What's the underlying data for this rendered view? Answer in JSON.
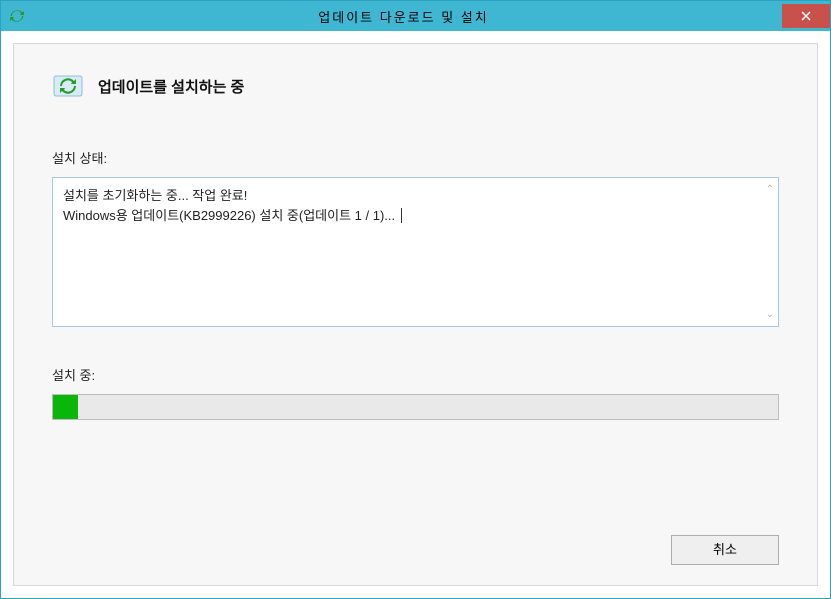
{
  "titlebar": {
    "title": "업데이트 다운로드 및 설치"
  },
  "header": {
    "title": "업데이트를 설치하는 중"
  },
  "status": {
    "label": "설치 상태:",
    "lines": [
      "설치를 초기화하는 중... 작업 완료!",
      "Windows용 업데이트(KB2999226) 설치 중(업데이트 1 / 1)..."
    ]
  },
  "progress": {
    "label": "설치 중:",
    "percent": 3.5
  },
  "buttons": {
    "cancel": "취소"
  }
}
